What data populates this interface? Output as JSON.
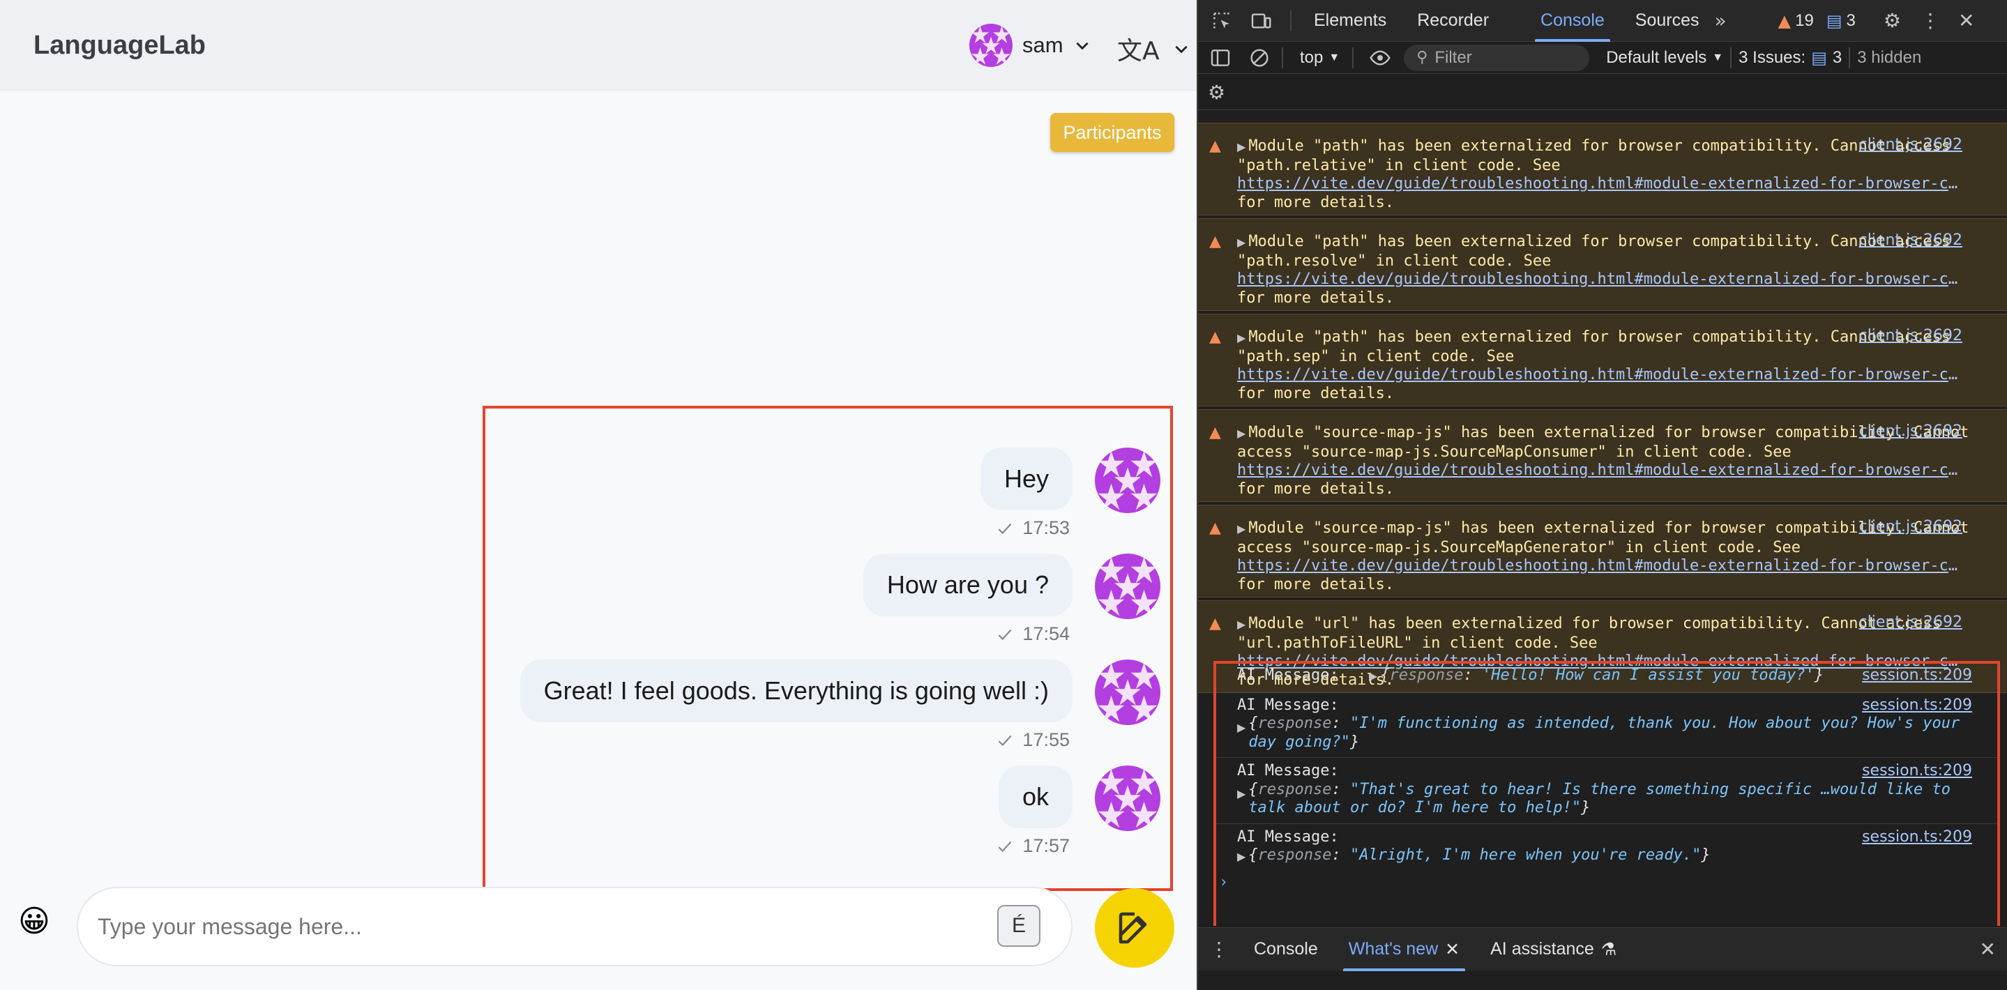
{
  "app": {
    "title": "LanguageLab",
    "user_name": "sam",
    "language_glyph": "文A",
    "participants_label": "Participants",
    "avatar_color": "#b33fe0",
    "messages": [
      {
        "text": "Hey",
        "time": "17:53"
      },
      {
        "text": "How are you ?",
        "time": "17:54"
      },
      {
        "text": "Great! I feel goods. Everything is going well :)",
        "time": "17:55"
      },
      {
        "text": "ok",
        "time": "17:57"
      }
    ],
    "composer": {
      "emoji": "😀",
      "placeholder": "Type your message here...",
      "accent_key": "É",
      "send_color": "#f6d404"
    }
  },
  "devtools": {
    "tabs": [
      "Elements",
      "Recorder",
      "Console",
      "Sources"
    ],
    "active_tab": "Console",
    "more_tabs": "»",
    "warnings_count": "19",
    "messages_count": "3",
    "toolbar": {
      "context": "top",
      "filter_placeholder": "Filter",
      "levels": "Default levels",
      "issues_label": "3 Issues:",
      "issues_count": "3",
      "hidden": "3 hidden"
    },
    "warnings": [
      {
        "text": "Module \"path\" has been externalized for browser compatibility. Cannot access \"path.relative\" in client code. See",
        "link": "https://vite.dev/guide/troubleshooting.html#module-externalized-for-browser-co…",
        "tail": "for more details.",
        "source": "client.js:2692"
      },
      {
        "text": "Module \"path\" has been externalized for browser compatibility. Cannot access \"path.resolve\" in client code. See",
        "link": "https://vite.dev/guide/troubleshooting.html#module-externalized-for-browser-co…",
        "tail": "for more details.",
        "source": "client.js:2692"
      },
      {
        "text": "Module \"path\" has been externalized for browser compatibility. Cannot access \"path.sep\" in client code. See",
        "link": "https://vite.dev/guide/troubleshooting.html#module-externalized-for-browser-co…",
        "tail": "for more details.",
        "source": "client.js:2692"
      },
      {
        "text": "Module \"source-map-js\" has been externalized for browser compatibility. Cannot access \"source-map-js.SourceMapConsumer\" in client code. See",
        "link": "https://vite.dev/guide/troubleshooting.html#module-externalized-for-browser-co…",
        "tail": "for more details.",
        "source": "client.js:2692"
      },
      {
        "text": "Module \"source-map-js\" has been externalized for browser compatibility. Cannot access \"source-map-js.SourceMapGenerator\" in client code. See",
        "link": "https://vite.dev/guide/troubleshooting.html#module-externalized-for-browser-co…",
        "tail": "for more details.",
        "source": "client.js:2692"
      },
      {
        "text": "Module \"url\" has been externalized for browser compatibility. Cannot access \"url.pathToFileURL\" in client code. See",
        "link": "https://vite.dev/guide/troubleshooting.html#module-externalized-for-browser-co…",
        "tail": "for more details.",
        "source": "client.js:2692"
      }
    ],
    "ai_logs": [
      {
        "label": "AI Message:",
        "key": "response",
        "value": "'Hello! How can I assist you today?'",
        "source": "session.ts:209",
        "inline": true
      },
      {
        "label": "AI Message:",
        "key": "response",
        "value": "\"I'm functioning as intended, thank you. How about you? How's your day going?\"",
        "source": "session.ts:209",
        "inline": false
      },
      {
        "label": "AI Message:",
        "key": "response",
        "value": "\"That's great to hear! Is there something specific …would like to talk about or do? I'm here to help!\"",
        "source": "session.ts:209",
        "inline": false
      },
      {
        "label": "AI Message:",
        "key": "response",
        "value": "\"Alright, I'm here when you're ready.\"",
        "source": "session.ts:209",
        "inline": false
      }
    ],
    "prompt_glyph": "›",
    "drawer_tabs": [
      "Console",
      "What's new",
      "AI assistance"
    ],
    "drawer_active": "What's new"
  }
}
